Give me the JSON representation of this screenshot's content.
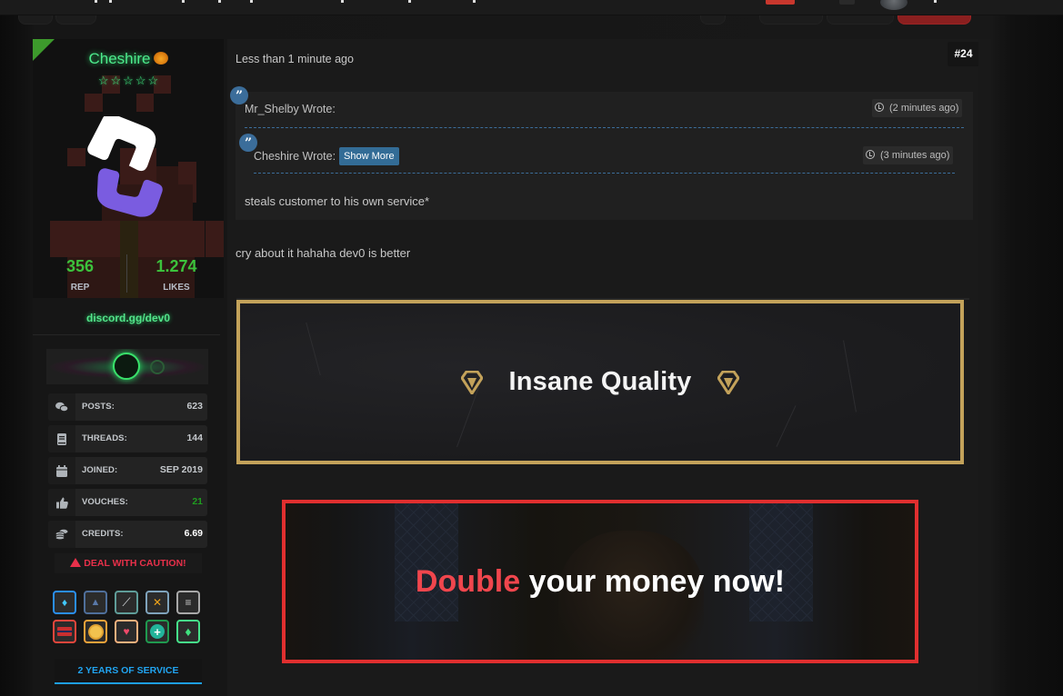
{
  "topbar": {
    "notification_color": "#c8372d"
  },
  "user": {
    "username": "Cheshire",
    "username_badge_icon": "pumpkin-icon",
    "stars": 5,
    "star_icon": "star-outline-icon",
    "rep_value": "356",
    "rep_label": "REP",
    "likes_value": "1.274",
    "likes_label": "LIKES",
    "discord": "discord.gg/dev0",
    "stats": [
      {
        "icon": "comments-icon",
        "label": "POSTS:",
        "value": "623"
      },
      {
        "icon": "book-icon",
        "label": "THREADS:",
        "value": "144"
      },
      {
        "icon": "calendar-icon",
        "label": "JOINED:",
        "value": "SEP 2019"
      },
      {
        "icon": "thumbs-up-icon",
        "label": "VOUCHES:",
        "value": "21"
      },
      {
        "icon": "coins-icon",
        "label": "CREDITS:",
        "value": "6.69"
      }
    ],
    "caution": "DEAL WITH CAUTION!",
    "awards": [
      {
        "icon": "blue-diamond-award-icon",
        "color": "#2a8ef0"
      },
      {
        "icon": "spy-award-icon",
        "color": "#4f6f9b"
      },
      {
        "icon": "syringe-award-icon",
        "color": "#5f9d99"
      },
      {
        "icon": "tools-award-icon",
        "color": "#7fa3bc"
      },
      {
        "icon": "coins-award-icon",
        "color": "#a9a9a9"
      },
      {
        "icon": "credit-card-award-icon",
        "color": "#e6463c"
      },
      {
        "icon": "sun-award-icon",
        "color": "#f0a23a"
      },
      {
        "icon": "heart-hand-award-icon",
        "color": "#f5b07d"
      },
      {
        "icon": "plus-award-icon",
        "color": "#1f9a4f"
      },
      {
        "icon": "green-gem-award-icon",
        "color": "#46e38a"
      }
    ],
    "service": "2 YEARS OF SERVICE"
  },
  "post": {
    "time": "Less than 1 minute ago",
    "number": "#24",
    "quote_outer": {
      "author": "Mr_Shelby Wrote:",
      "time": "(2 minutes ago)",
      "body": "steals customer to his own service*"
    },
    "quote_inner": {
      "author": "Cheshire Wrote:",
      "show_more": "Show More",
      "time": "(3 minutes ago)"
    },
    "text": "cry about it hahaha dev0 is better"
  },
  "ads": {
    "ad1_title": "Insane Quality",
    "ad1_border": "#c3a25a",
    "ad2_title_highlight": "Double",
    "ad2_title_rest": " your money now!",
    "ad2_border": "#e02f2f"
  }
}
